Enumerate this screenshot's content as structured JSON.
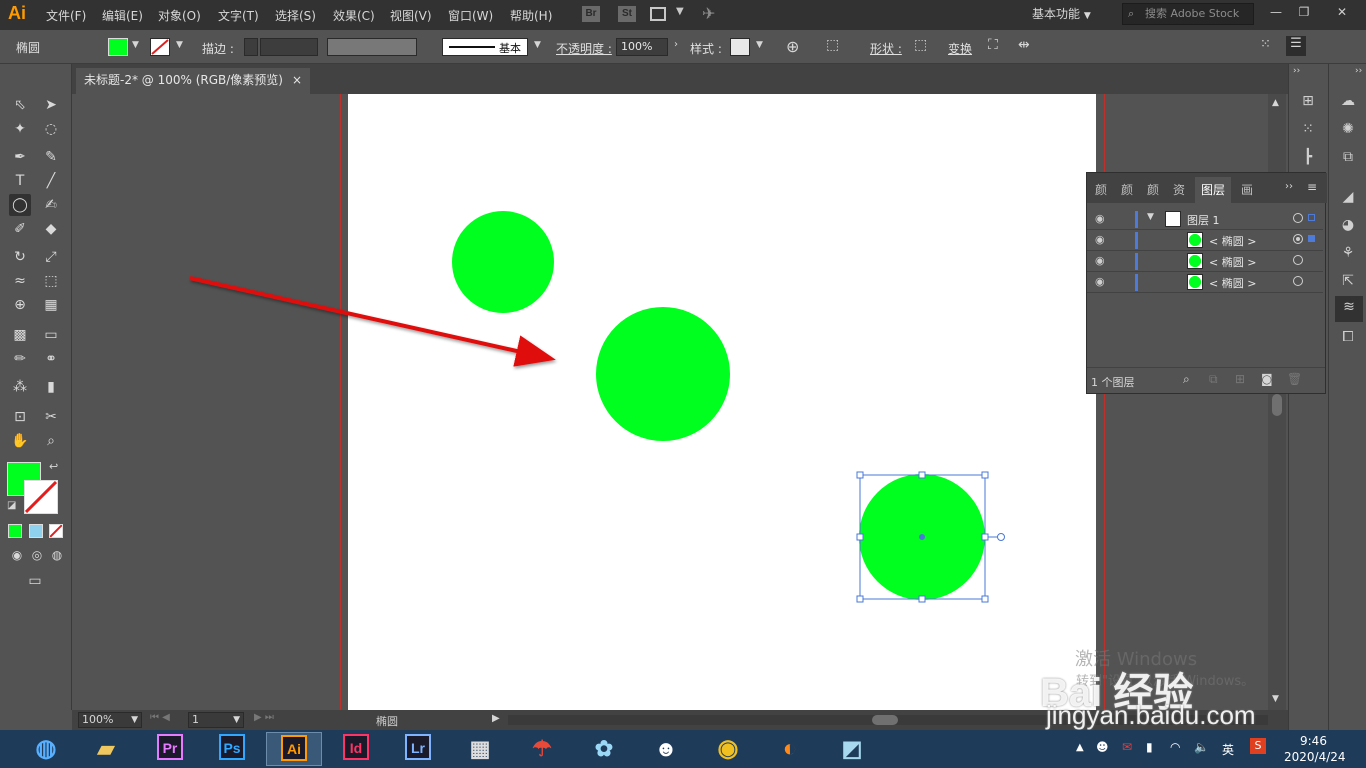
{
  "app": {
    "logo": "Ai"
  },
  "menu": [
    "文件(F)",
    "编辑(E)",
    "对象(O)",
    "文字(T)",
    "选择(S)",
    "效果(C)",
    "视图(V)",
    "窗口(W)",
    "帮助(H)"
  ],
  "bridge": {
    "br": "Br",
    "st": "St"
  },
  "workspace": "基本功能",
  "search_placeholder": "搜索 Adobe Stock",
  "control": {
    "selection": "椭圆",
    "fill_color": "#00ff1e",
    "stroke_label": "描边 :",
    "stroke_style": "基本",
    "opacity_label": "不透明度 :",
    "opacity_value": "100%",
    "style_label": "样式 :",
    "shape_label": "形状 :",
    "transform_label": "变换"
  },
  "document_tab": {
    "title": "未标题-2* @ 100% (RGB/像素预览)",
    "close": "×"
  },
  "canvas": {
    "shape_color": "#00ff1e",
    "arrow_color": "#e01010",
    "selection_color": "#4a78d8"
  },
  "status": {
    "zoom": "100%",
    "artboard": "1",
    "tool": "椭圆"
  },
  "layers_panel": {
    "tabs": [
      "颜",
      "颜",
      "颜",
      "资",
      "图层",
      "画"
    ],
    "active_tab": "图层",
    "rows": [
      {
        "name": "图层 1",
        "kind": "layer"
      },
      {
        "name": "< 椭圆 >",
        "kind": "path"
      },
      {
        "name": "< 椭圆 >",
        "kind": "path"
      },
      {
        "name": "< 椭圆 >",
        "kind": "path"
      }
    ],
    "footer": "1 个图层"
  },
  "taskbar": {
    "apps": [
      "Pr",
      "Ps",
      "Ai",
      "Id",
      "Lr"
    ],
    "app_colors": {
      "Pr": "#e77bff",
      "Ps": "#31a8ff",
      "Ai": "#ff9a00",
      "Id": "#ff3366",
      "Lr": "#7fb3ff"
    },
    "ime": "英",
    "time": "9:46",
    "date": "2020/4/24"
  },
  "watermark": {
    "activate": "激活 Windows",
    "activate_sub": "转到\"设置\"以激活 Windows。",
    "brand": "Bai 经验",
    "url": "jingyan.baidu.com"
  }
}
